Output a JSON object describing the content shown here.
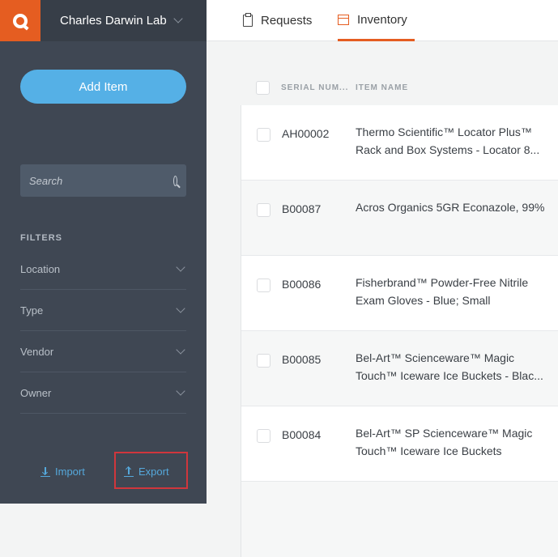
{
  "sidebar": {
    "lab_name": "Charles Darwin Lab",
    "add_item_label": "Add Item",
    "search_placeholder": "Search",
    "filters_title": "FILTERS",
    "filters": [
      {
        "label": "Location"
      },
      {
        "label": "Type"
      },
      {
        "label": "Vendor"
      },
      {
        "label": "Owner"
      }
    ],
    "import_label": "Import",
    "export_label": "Export"
  },
  "tabs": [
    {
      "label": "Requests",
      "icon": "clipboard-icon"
    },
    {
      "label": "Inventory",
      "icon": "box-icon",
      "active": true
    }
  ],
  "table": {
    "columns": [
      "SERIAL NUM...",
      "ITEM NAME"
    ],
    "rows": [
      {
        "serial": "AH00002",
        "name": "Thermo Scientific™ Locator Plus™ Rack and Box Systems - Locator 8..."
      },
      {
        "serial": "B00087",
        "name": "Acros Organics 5GR Econazole, 99%"
      },
      {
        "serial": "B00086",
        "name": "Fisherbrand™ Powder-Free Nitrile Exam Gloves - Blue; Small"
      },
      {
        "serial": "B00085",
        "name": "Bel-Art™ Scienceware™ Magic Touch™ Iceware Ice Buckets - Blac..."
      },
      {
        "serial": "B00084",
        "name": "Bel-Art™ SP Scienceware™ Magic Touch™ Iceware Ice Buckets"
      }
    ]
  },
  "colors": {
    "brand": "#e55d21",
    "accent": "#55b0e6",
    "highlight": "#d0363c"
  }
}
